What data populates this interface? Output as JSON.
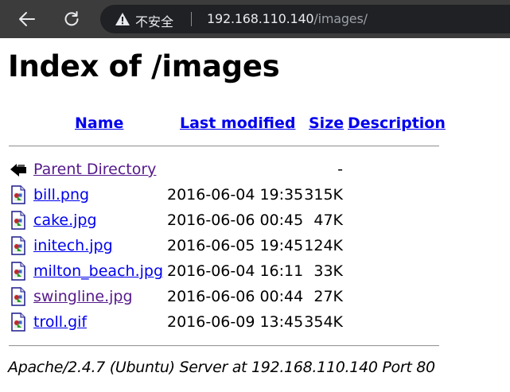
{
  "browser": {
    "security_label": "不安全",
    "url_host": "192.168.110.140",
    "url_path": "/images/",
    "icons": {
      "back": "arrow-left-icon",
      "reload": "reload-icon",
      "security": "warning-icon"
    }
  },
  "page": {
    "title": "Index of /images",
    "columns": {
      "name": "Name",
      "last_modified": "Last modified",
      "size": "Size",
      "description": "Description"
    },
    "parent": {
      "label": "Parent Directory",
      "size": "-",
      "icon": "back-folder-icon"
    },
    "files": [
      {
        "name": "bill.png",
        "modified": "2016-06-04 19:35",
        "size": "315K",
        "icon": "image-file-icon"
      },
      {
        "name": "cake.jpg",
        "modified": "2016-06-06 00:45",
        "size": "47K",
        "icon": "image-file-icon"
      },
      {
        "name": "initech.jpg",
        "modified": "2016-06-05 19:45",
        "size": "124K",
        "icon": "image-file-icon"
      },
      {
        "name": "milton_beach.jpg",
        "modified": "2016-06-04 16:11",
        "size": "33K",
        "icon": "image-file-icon"
      },
      {
        "name": "swingline.jpg",
        "modified": "2016-06-06 00:44",
        "size": "27K",
        "icon": "image-file-icon"
      },
      {
        "name": "troll.gif",
        "modified": "2016-06-09 13:45",
        "size": "354K",
        "icon": "image-file-icon"
      }
    ],
    "address": "Apache/2.4.7 (Ubuntu) Server at 192.168.110.140 Port 80"
  },
  "colors": {
    "link": "#0000ee",
    "visited_link": "#551a8b",
    "toolbar": "#3c3c3c",
    "omnibox": "#202124"
  }
}
